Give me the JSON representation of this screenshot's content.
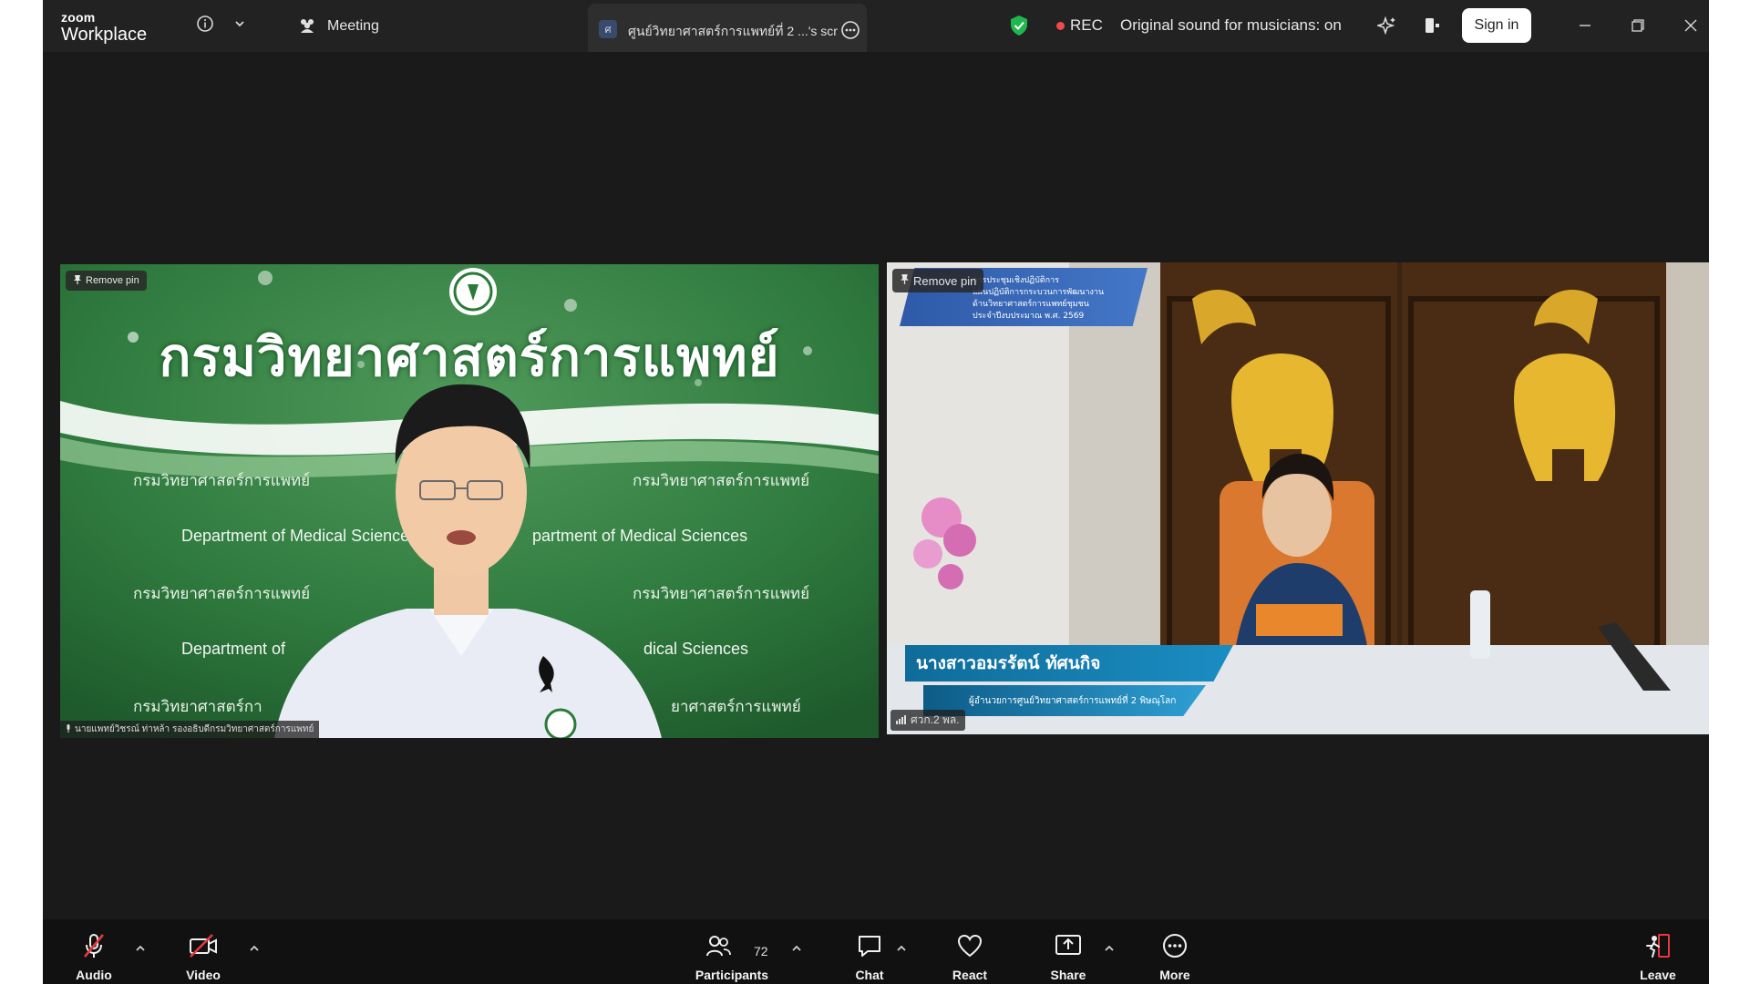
{
  "window": {
    "app_logo_top": "zoom",
    "app_logo_bottom": "Workplace",
    "meeting_label": "Meeting",
    "share_tab_title": "ศูนย์วิทยาศาสตร์การแพทย์ที่ 2 ...'s scr",
    "share_tab_icon_letter": "ศ",
    "rec_label": "REC",
    "original_sound": "Original sound for musicians: on",
    "sign_in": "Sign in",
    "icons": [
      "info-icon",
      "chevron-down-icon",
      "participants-icon",
      "more-icon",
      "shield-icon",
      "sparkle-icon",
      "side-panel-icon",
      "minimize-icon",
      "restore-icon",
      "close-icon"
    ],
    "colors": {
      "bg": "#1a1a1a",
      "topbar": "#222222",
      "toolbar": "#111111",
      "rec_dot": "#f04a4a",
      "shield": "#1fb84f",
      "muted": "#e5393f"
    }
  },
  "tiles": [
    {
      "pin_label": "Remove pin",
      "name": "นายแพทย์วิชรณ์ ท่าหล้า รองอธิบดีกรมวิทยาศาสตร์การแพทย์",
      "background": {
        "title": "กรมวิทยาศาสตร์การแพทย์",
        "th_line": "กรมวิทยาศาสตร์การแพทย์",
        "en_line": "Department of Medical Sciences",
        "en_partial_right": "partment of Medical Sciences",
        "en_partial_left": "Department of",
        "en_partial_right2": "dical Sciences",
        "th_partial_left": "กรมวิทยาศาสตร์กา",
        "th_partial_right": "ยาศาสตร์การแพทย์"
      }
    },
    {
      "pin_label": "Remove pin",
      "name": "ศวก.2 พล.",
      "banner_line1": "การประชุมเชิงปฏิบัติการ",
      "banner_line2": "แผนปฏิบัติการกระบวนการพัฒนางาน",
      "banner_line3": "ด้านวิทยาศาสตร์การแพทย์ชุมชน",
      "banner_line4": "ประจำปีงบประมาณ พ.ศ. 2569",
      "lower_third_name": "นางสาวอมรรัตน์ ทัศนกิจ",
      "lower_third_title": "ผู้อำนวยการศูนย์วิทยาศาสตร์การแพทย์ที่ 2 พิษณุโลก"
    }
  ],
  "toolbar": {
    "audio": "Audio",
    "video": "Video",
    "participants": "Participants",
    "participant_count": "72",
    "chat": "Chat",
    "react": "React",
    "share": "Share",
    "more": "More",
    "leave": "Leave"
  }
}
